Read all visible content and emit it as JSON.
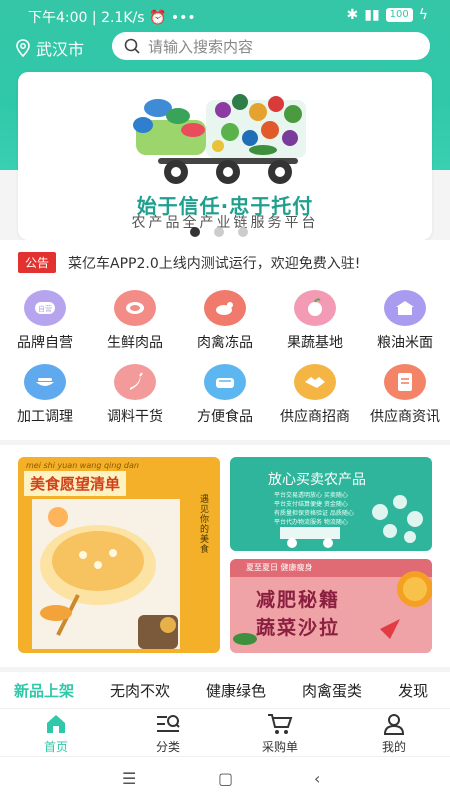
{
  "status": {
    "time": "下午4:00",
    "speed": "2.1K/s",
    "battery": "100"
  },
  "location": {
    "city": "武汉市"
  },
  "search": {
    "placeholder": "请输入搜索内容"
  },
  "banner": {
    "slogan": "始于信任·忠于托付",
    "subtitle": "农产品全产业链服务平台",
    "dots": 3,
    "active_dot": 0
  },
  "notice": {
    "tag": "公告",
    "text": "菜亿车APP2.0上线内测试运行，欢迎免费入驻!"
  },
  "categories": [
    {
      "label": "品牌自营",
      "icon": "brand-badge-icon",
      "color": "#b7a4ef"
    },
    {
      "label": "生鲜肉品",
      "icon": "meat-icon",
      "color": "#f38b86"
    },
    {
      "label": "肉禽冻品",
      "icon": "poultry-icon",
      "color": "#f07a6b"
    },
    {
      "label": "果蔬基地",
      "icon": "fruit-icon",
      "color": "#f39bb4"
    },
    {
      "label": "粮油米面",
      "icon": "granary-icon",
      "color": "#a99cf0"
    },
    {
      "label": "加工调理",
      "icon": "processing-icon",
      "color": "#5fa9ef"
    },
    {
      "label": "调料干货",
      "icon": "chili-icon",
      "color": "#f39b9b"
    },
    {
      "label": "方便食品",
      "icon": "noodle-box-icon",
      "color": "#5cb7f0"
    },
    {
      "label": "供应商招商",
      "icon": "handshake-icon",
      "color": "#f4b545"
    },
    {
      "label": "供应商资讯",
      "icon": "document-icon",
      "color": "#f38468"
    }
  ],
  "promos": {
    "card1": {
      "title": "美食愿望清单",
      "pinyin": "mei shi yuan wang qing dan",
      "side": "遇见你的美食"
    },
    "card2": {
      "title": "放心买卖农产品",
      "lines": [
        "平台交易透明放心  买卖随心",
        "平台支付结算便捷  资金随心",
        "有质量担保资格验证  品质随心",
        "平台代办物流服务  物流随心"
      ]
    },
    "card3": {
      "tag": "夏至夏日 健康瘦身",
      "title1": "减肥秘籍",
      "title2": "蔬菜沙拉"
    }
  },
  "tabs": [
    "新品上架",
    "无肉不欢",
    "健康绿色",
    "肉禽蛋类",
    "发现"
  ],
  "bottom_nav": [
    {
      "label": "首页",
      "icon": "home-icon"
    },
    {
      "label": "分类",
      "icon": "category-search-icon"
    },
    {
      "label": "采购单",
      "icon": "cart-icon"
    },
    {
      "label": "我的",
      "icon": "profile-icon"
    }
  ],
  "colors": {
    "accent": "#2fc8a8",
    "notice": "#e2312f",
    "promo1": "#f4b028",
    "promo2": "#2fb59b",
    "promo3": "#efa3a6"
  }
}
